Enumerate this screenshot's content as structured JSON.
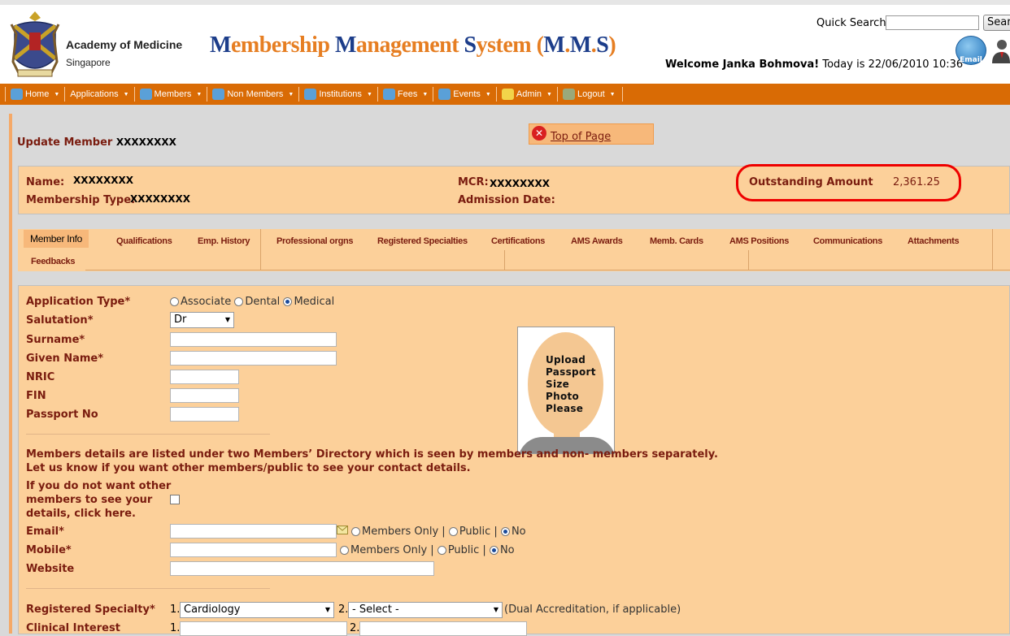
{
  "header": {
    "org_name": "Academy of Medicine",
    "org_sub": "Singapore",
    "app_title_parts": [
      {
        "text": "M",
        "cap": true
      },
      {
        "text": "embership ",
        "cap": false
      },
      {
        "text": "M",
        "cap": true
      },
      {
        "text": "anagement ",
        "cap": false
      },
      {
        "text": "S",
        "cap": true
      },
      {
        "text": "ystem (",
        "cap": false
      },
      {
        "text": "M",
        "cap": true
      },
      {
        "text": ".",
        "cap": false
      },
      {
        "text": "M",
        "cap": true
      },
      {
        "text": ".",
        "cap": false
      },
      {
        "text": "S",
        "cap": true
      },
      {
        "text": ")",
        "cap": false
      }
    ],
    "quick_search_label": "Quick Search",
    "search_button": "Search",
    "welcome_name": "Welcome Janka Bohmova!",
    "welcome_date": " Today is 22/06/2010 10:36",
    "email_icon_label": "Email"
  },
  "menu": [
    {
      "label": "Home",
      "icon": "home-icon",
      "color": "#5aa0d8"
    },
    {
      "label": "Applications",
      "icon": null,
      "color": null
    },
    {
      "label": "Members",
      "icon": "members-icon",
      "color": "#5aa0d8"
    },
    {
      "label": "Non Members",
      "icon": "non-members-icon",
      "color": "#5aa0d8"
    },
    {
      "label": "Institutions",
      "icon": "institutions-icon",
      "color": "#5aa0d8"
    },
    {
      "label": "Fees",
      "icon": "fees-icon",
      "color": "#5aa0d8"
    },
    {
      "label": "Events",
      "icon": "events-icon",
      "color": "#5aa0d8"
    },
    {
      "label": "Admin",
      "icon": "key-icon",
      "color": "#f2d44a"
    },
    {
      "label": "Logout",
      "icon": "logout-icon",
      "color": "#9aa97a"
    }
  ],
  "page": {
    "update_title": "Update Member",
    "update_id": "XXXXXXXX",
    "top_of_page": "Top of Page"
  },
  "member": {
    "name_label": "Name:",
    "name_value": "XXXXXXXX",
    "type_label": "Membership Type:",
    "type_value": "XXXXXXXX",
    "mcr_label": "MCR:",
    "mcr_value": "XXXXXXXX",
    "admission_label": "Admission Date:",
    "outstanding_label": "Outstanding Amount",
    "outstanding_value": "2,361.25"
  },
  "tabs": {
    "active": "Member Info",
    "row1": [
      "Qualifications",
      "Emp. History",
      "Professional orgns",
      "Registered Specialties",
      "Certifications",
      "AMS Awards",
      "Memb. Cards",
      "AMS Positions",
      "Communications",
      "Attachments"
    ],
    "row2": [
      "Feedbacks"
    ]
  },
  "form": {
    "application_type_label": "Application Type*",
    "application_types": [
      {
        "label": "Associate",
        "selected": false
      },
      {
        "label": "Dental",
        "selected": false
      },
      {
        "label": "Medical",
        "selected": true
      }
    ],
    "salutation_label": "Salutation*",
    "salutation_value": "Dr",
    "surname_label": "Surname*",
    "given_name_label": "Given Name*",
    "nric_label": "NRIC",
    "fin_label": "FIN",
    "passport_label": "Passport No",
    "photo_lines": [
      "Upload",
      "Passport",
      "Size",
      "Photo",
      "Please"
    ],
    "directory_note_1": "Members details are listed under two Members’ Directory which is seen by members and non- members separately.",
    "directory_note_2": "Let us know if you want other members/public to see your contact details.",
    "hide_details_label_1": "If you do not want other",
    "hide_details_label_2": "members to see your",
    "hide_details_label_3": "details, click here.",
    "email_label": "Email*",
    "mobile_label": "Mobile*",
    "website_label": "Website",
    "visibility_options": [
      "Members Only |",
      "Public |",
      "No"
    ],
    "registered_specialty_label": "Registered Specialty*",
    "specialty_1_prefix": "1.",
    "specialty_1_value": "Cardiology",
    "specialty_2_prefix": "2.",
    "specialty_2_value": "- Select -",
    "dual_note": "(Dual Accreditation, if applicable)",
    "clinical_interest_label": "Clinical Interest",
    "clinical_1_prefix": "1.",
    "clinical_2_prefix": "2."
  }
}
